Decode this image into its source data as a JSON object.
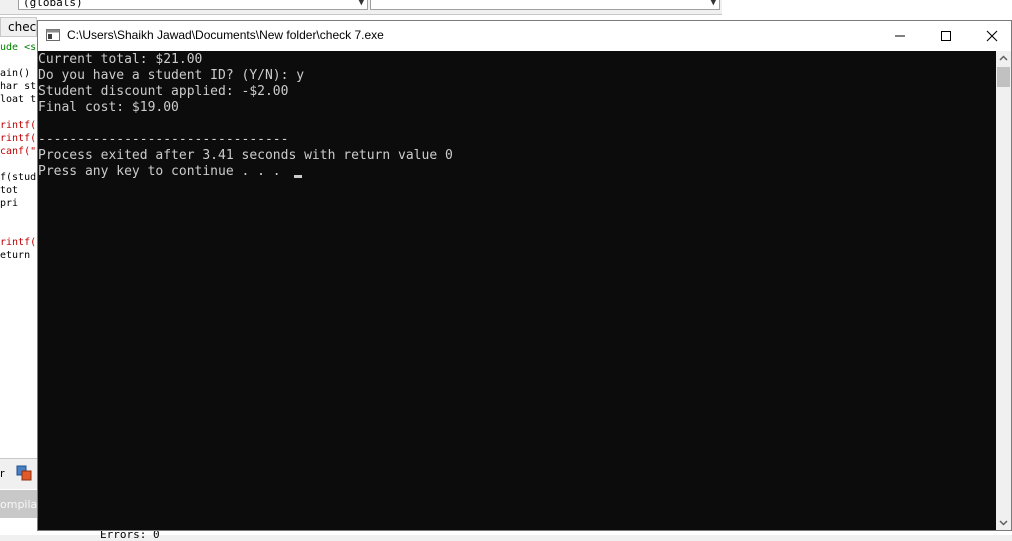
{
  "ide": {
    "function_combo": "(globals)",
    "tab_label": "check",
    "code_lines": [
      {
        "text": "ude <s",
        "style": "green"
      },
      {
        "text": "ain()",
        "style": "normal"
      },
      {
        "text": "har st",
        "style": "normal"
      },
      {
        "text": "loat t",
        "style": "normal"
      },
      {
        "text": "rintf(",
        "style": "red"
      },
      {
        "text": "rintf(",
        "style": "red"
      },
      {
        "text": "canf(\"",
        "style": "red"
      },
      {
        "text": "f(stud",
        "style": "normal"
      },
      {
        "text": " tot",
        "style": "normal"
      },
      {
        "text": " pri",
        "style": "normal"
      },
      {
        "text": "rintf(",
        "style": "red"
      },
      {
        "text": "eturn",
        "style": "normal"
      }
    ],
    "split_label": "r",
    "bottom_tab": "ompila",
    "errors_text": "Errors: 0"
  },
  "window": {
    "title": "C:\\Users\\Shaikh Jawad\\Documents\\New folder\\check 7.exe",
    "minimize_icon": "minimize-icon",
    "maximize_icon": "maximize-icon",
    "close_icon": "close-icon"
  },
  "console": {
    "lines": [
      "Current total: $21.00",
      "Do you have a student ID? (Y/N): y",
      "Student discount applied: -$2.00",
      "Final cost: $19.00",
      "",
      "--------------------------------",
      "Process exited after 3.41 seconds with return value 0",
      "Press any key to continue . . . "
    ],
    "text_color": "#cccccc",
    "background": "#0c0c0c"
  }
}
